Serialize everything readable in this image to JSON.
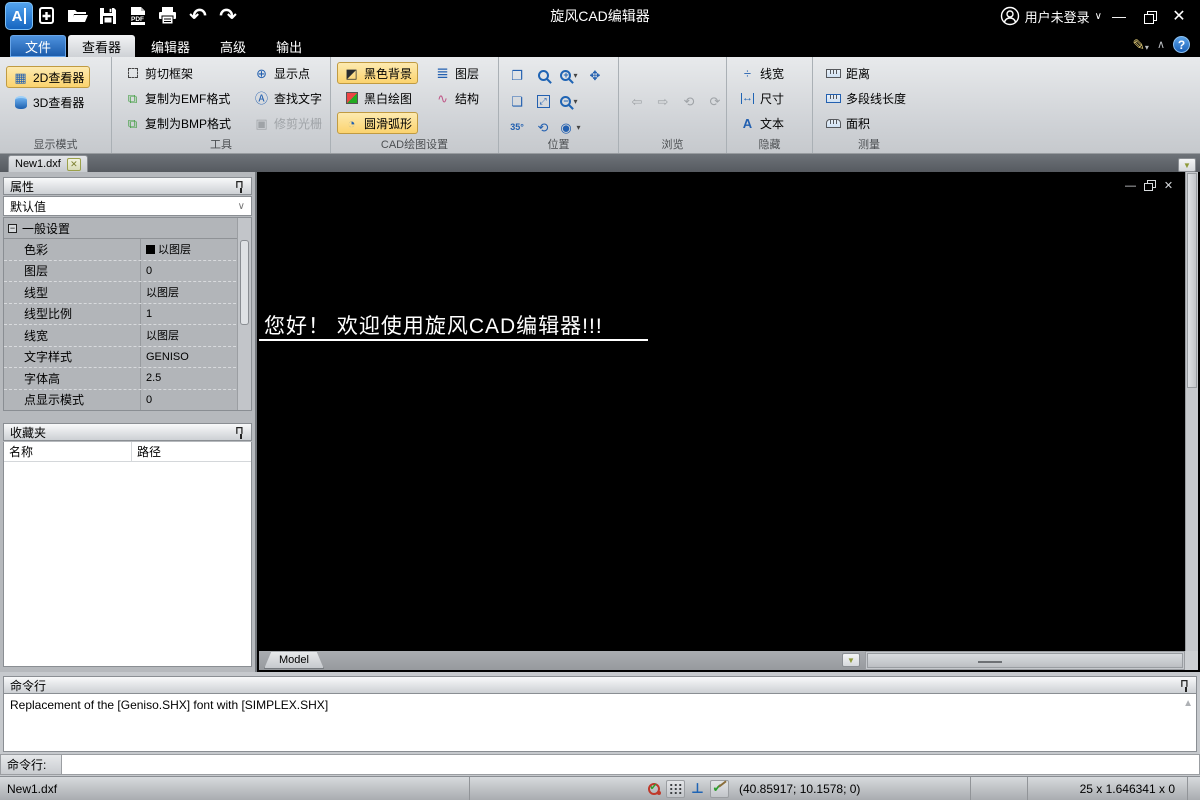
{
  "titlebar": {
    "title": "旋风CAD编辑器",
    "user": "用户未登录"
  },
  "menu": {
    "tabs": [
      {
        "label": "文件"
      },
      {
        "label": "查看器"
      },
      {
        "label": "编辑器"
      },
      {
        "label": "高级"
      },
      {
        "label": "输出"
      }
    ]
  },
  "ribbon": {
    "groups": [
      {
        "label": "显示模式",
        "buttons": [
          {
            "label": "2D查看器"
          },
          {
            "label": "3D查看器"
          }
        ]
      },
      {
        "label": "工具",
        "buttons": [
          {
            "label": "剪切框架"
          },
          {
            "label": "复制为EMF格式"
          },
          {
            "label": "复制为BMP格式"
          },
          {
            "label": "显示点"
          },
          {
            "label": "查找文字"
          },
          {
            "label": "修剪光栅"
          }
        ]
      },
      {
        "label": "CAD绘图设置",
        "buttons": [
          {
            "label": "黑色背景"
          },
          {
            "label": "黑白绘图"
          },
          {
            "label": "圆滑弧形"
          },
          {
            "label": "图层"
          },
          {
            "label": "结构"
          }
        ]
      },
      {
        "label": "位置",
        "rotate_angle": "35°"
      },
      {
        "label": "浏览"
      },
      {
        "label": "隐藏",
        "buttons": [
          {
            "label": "线宽"
          },
          {
            "label": "尺寸"
          },
          {
            "label": "文本"
          }
        ]
      },
      {
        "label": "测量",
        "buttons": [
          {
            "label": "距离"
          },
          {
            "label": "多段线长度"
          },
          {
            "label": "面积"
          }
        ]
      }
    ]
  },
  "document_tab": {
    "label": "New1.dxf"
  },
  "properties": {
    "title": "属性",
    "preset": "默认值",
    "group_label": "一般设置",
    "rows": [
      {
        "name": "色彩",
        "value": "以图层"
      },
      {
        "name": "图层",
        "value": "0"
      },
      {
        "name": "线型",
        "value": "以图层"
      },
      {
        "name": "线型比例",
        "value": "1"
      },
      {
        "name": "线宽",
        "value": "以图层"
      },
      {
        "name": "文字样式",
        "value": "GENISO"
      },
      {
        "name": "字体高",
        "value": "2.5"
      },
      {
        "name": "点显示模式",
        "value": "0"
      }
    ]
  },
  "favorites": {
    "title": "收藏夹",
    "col_name": "名称",
    "col_path": "路径"
  },
  "canvas": {
    "welcome": "您好！ 欢迎使用旋风CAD编辑器!!!",
    "model_tab": "Model"
  },
  "command": {
    "title": "命令行",
    "message": "Replacement of the [Geniso.SHX] font with [SIMPLEX.SHX]",
    "prompt": "命令行:",
    "input_value": ""
  },
  "statusbar": {
    "file": "New1.dxf",
    "coordinates": "(40.85917; 10.1578; 0)",
    "dimensions": "25 x 1.646341 x 0"
  }
}
